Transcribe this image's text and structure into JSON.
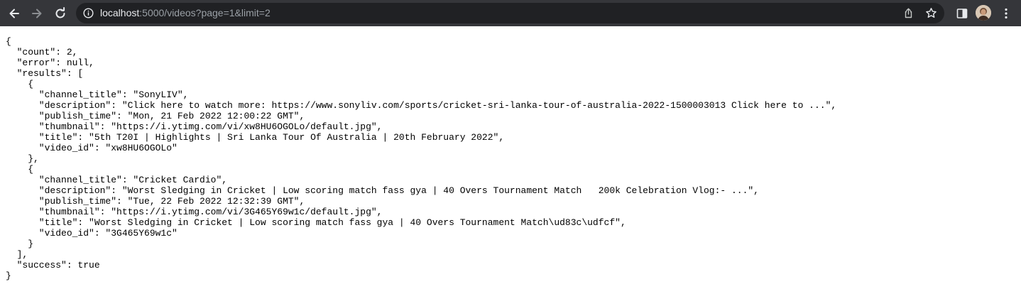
{
  "browser": {
    "url_host": "localhost",
    "url_rest": ":5000/videos?page=1&limit=2",
    "icons": {
      "back": "arrow-left-icon",
      "forward": "arrow-right-icon",
      "reload": "reload-icon",
      "info": "info-circle-icon",
      "share": "share-icon",
      "bookmark": "star-icon",
      "side_panel": "side-panel-icon",
      "profile": "avatar",
      "menu": "kebab-menu-icon"
    },
    "colors": {
      "toolbar_bg": "#35363a",
      "omnibox_bg": "#202124",
      "host_text": "#e8eaed",
      "muted_text": "#9aa0a6"
    }
  },
  "json_body": "{\n  \"count\": 2,\n  \"error\": null,\n  \"results\": [\n    {\n      \"channel_title\": \"SonyLIV\",\n      \"description\": \"Click here to watch more: https://www.sonyliv.com/sports/cricket-sri-lanka-tour-of-australia-2022-1500003013 Click here to ...\",\n      \"publish_time\": \"Mon, 21 Feb 2022 12:00:22 GMT\",\n      \"thumbnail\": \"https://i.ytimg.com/vi/xw8HU6OGOLo/default.jpg\",\n      \"title\": \"5th T20I | Highlights | Sri Lanka Tour Of Australia | 20th February 2022\",\n      \"video_id\": \"xw8HU6OGOLo\"\n    },\n    {\n      \"channel_title\": \"Cricket Cardio\",\n      \"description\": \"Worst Sledging in Cricket | Low scoring match fass gya | 40 Overs Tournament Match   200k Celebration Vlog:- ...\",\n      \"publish_time\": \"Tue, 22 Feb 2022 12:32:39 GMT\",\n      \"thumbnail\": \"https://i.ytimg.com/vi/3G465Y69w1c/default.jpg\",\n      \"title\": \"Worst Sledging in Cricket | Low scoring match fass gya | 40 Overs Tournament Match\\ud83c\\udfcf\",\n      \"video_id\": \"3G465Y69w1c\"\n    }\n  ],\n  \"success\": true\n}"
}
